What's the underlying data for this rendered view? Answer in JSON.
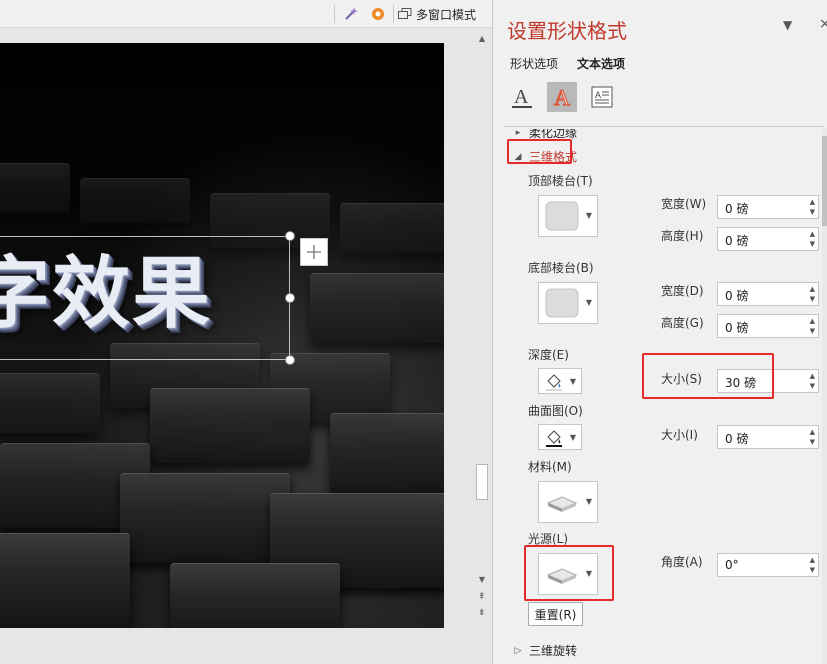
{
  "toolbar": {
    "multiwindow_label": "多窗口模式"
  },
  "slide": {
    "visible_text": "字效果"
  },
  "panel": {
    "title": "设置形状格式",
    "tabs": [
      "形状选项",
      "文本选项"
    ],
    "active_tab": "文本选项",
    "section_partial": "柔化边缘",
    "section_3d_format": "三维格式",
    "top_bevel_label": "顶部棱台(T)",
    "bottom_bevel_label": "底部棱台(B)",
    "width_w_label": "宽度(W)",
    "height_h_label": "高度(H)",
    "width_d_label": "宽度(D)",
    "height_g_label": "高度(G)",
    "top_width_value": "0 磅",
    "top_height_value": "0 磅",
    "bottom_width_value": "0 磅",
    "bottom_height_value": "0 磅",
    "depth_label": "深度(E)",
    "depth_size_label": "大小(S)",
    "depth_size_value": "30 磅",
    "contour_label": "曲面图(O)",
    "contour_size_label": "大小(I)",
    "contour_size_value": "0 磅",
    "material_label": "材料(M)",
    "lighting_label": "光源(L)",
    "angle_label": "角度(A)",
    "angle_value": "0°",
    "reset_label": "重置(R)",
    "section_3d_rotation": "三维旋转"
  },
  "colors": {
    "title_red": "#c0392b",
    "highlight_red": "#e22a2a"
  }
}
